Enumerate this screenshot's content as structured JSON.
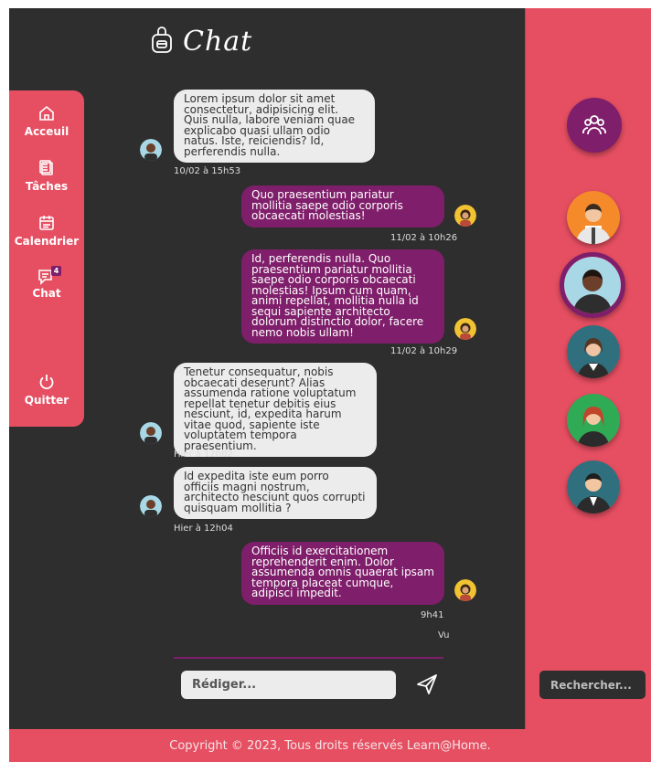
{
  "header": {
    "title": "Chat",
    "icon": "backpack-icon"
  },
  "sidebar": {
    "items": [
      {
        "label": "Acceuil",
        "icon": "home-icon"
      },
      {
        "label": "Tâches",
        "icon": "clipboard-icon"
      },
      {
        "label": "Calendrier",
        "icon": "calendar-icon"
      },
      {
        "label": "Chat",
        "icon": "chat-icon",
        "badge": "4"
      },
      {
        "label": "Quitter",
        "icon": "power-icon"
      }
    ]
  },
  "messages": [
    {
      "direction": "in",
      "text": "Lorem ipsum dolor sit amet consectetur, adipisicing elit. Quis nulla, labore veniam quae explicabo quasi ullam odio natus. Iste, reiciendis? Id, perferendis nulla.",
      "time": "10/02 à 15h53"
    },
    {
      "direction": "out",
      "text": "Quo praesentium pariatur mollitia saepe odio corporis obcaecati molestias!",
      "time": "11/02 à 10h26"
    },
    {
      "direction": "out",
      "text": "Id, perferendis nulla. Quo praesentium pariatur mollitia saepe odio corporis obcaecati molestias! Ipsum cum quam, animi repellat, mollitia nulla id sequi sapiente architecto dolorum distinctio dolor, facere nemo nobis ullam!",
      "time": "11/02 à 10h29"
    },
    {
      "direction": "in",
      "text": "Tenetur consequatur, nobis obcaecati deserunt? Alias assumenda ratione voluptatum repellat tenetur debitis eius nesciunt, id, expedita harum vitae quod, sapiente iste voluptatem tempora praesentium.",
      "time": "Hier à 12h02"
    },
    {
      "direction": "in",
      "text": "Id expedita iste eum porro officiis magni nostrum, architecto nesciunt quos corrupti quisquam mollitia ?",
      "time": "Hier à 12h04"
    },
    {
      "direction": "out",
      "text": "Officiis id exercitationem reprehenderit enim. Dolor assumenda omnis quaerat ipsam tempora placeat cumque, adipisci impedit.",
      "time": "9h41",
      "status": "Vu"
    }
  ],
  "compose": {
    "placeholder": "Rédiger..."
  },
  "search": {
    "placeholder": "Rechercher..."
  },
  "footer": {
    "text": "Copyright © 2023, Tous droits réservés Learn@Home."
  },
  "colors": {
    "accent": "#e64f62",
    "bubble_out": "#7f1e6a",
    "bubble_in": "#ececec",
    "background": "#2e2e2e"
  }
}
